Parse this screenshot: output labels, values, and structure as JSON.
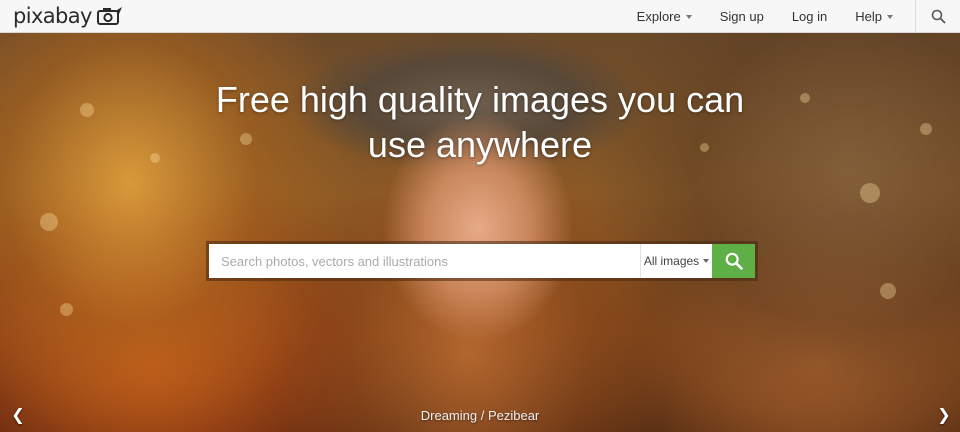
{
  "brand": {
    "name": "pixabay",
    "logo_icon": "camera-icon"
  },
  "nav": {
    "items": [
      {
        "label": "Explore",
        "has_dropdown": true
      },
      {
        "label": "Sign up",
        "has_dropdown": false
      },
      {
        "label": "Log in",
        "has_dropdown": false
      },
      {
        "label": "Help",
        "has_dropdown": true
      }
    ],
    "search_icon": "search-icon"
  },
  "hero": {
    "headline_line1": "Free high quality images you can",
    "headline_line2": "use anywhere",
    "search": {
      "placeholder": "Search photos, vectors and illustrations",
      "value": "",
      "type_selected": "All images",
      "button_icon": "search-icon"
    },
    "caption": "Dreaming / Pezibear",
    "prev_icon": "chevron-left-icon",
    "next_icon": "chevron-right-icon"
  },
  "colors": {
    "accent_green": "#5daf46",
    "topbar_bg": "#f7f7f7"
  }
}
